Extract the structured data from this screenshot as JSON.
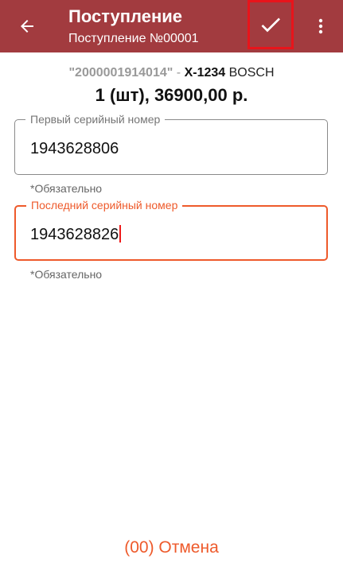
{
  "header": {
    "title": "Поступление",
    "subtitle": "Поступление №00001"
  },
  "product": {
    "barcode": "\"2000001914014\"",
    "separator": "-",
    "article": "X-1234",
    "brand": "BOSCH",
    "quantity_price": "1 (шт), 36900,00 р."
  },
  "fields": {
    "first_serial": {
      "label": "Первый серийный номер",
      "value": "1943628806",
      "helper": "*Обязательно"
    },
    "last_serial": {
      "label": "Последний серийный номер",
      "value": "1943628826",
      "helper": "*Обязательно"
    }
  },
  "footer": {
    "cancel_label": "(00) Отмена"
  },
  "colors": {
    "appbar": "#a23b3f",
    "accent": "#ee5a2b",
    "highlight_border": "#e8141b"
  },
  "icons": {
    "back": "arrow-back-icon",
    "confirm": "checkmark-icon",
    "menu": "more-vert-icon"
  }
}
